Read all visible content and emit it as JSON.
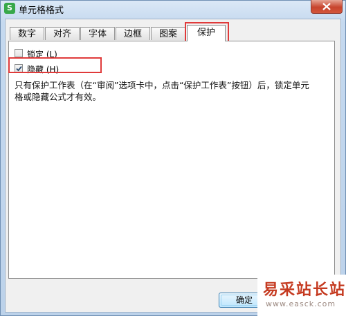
{
  "window": {
    "title": "单元格格式",
    "app_icon_letter": "S"
  },
  "tabs": [
    {
      "label": "数字",
      "active": false
    },
    {
      "label": "对齐",
      "active": false
    },
    {
      "label": "字体",
      "active": false
    },
    {
      "label": "边框",
      "active": false
    },
    {
      "label": "图案",
      "active": false
    },
    {
      "label": "保护",
      "active": true
    }
  ],
  "protection": {
    "locked": {
      "label": "锁定 (L)",
      "checked": false
    },
    "hidden": {
      "label": "隐藏 (H)",
      "checked": true
    },
    "description": "只有保护工作表（在“审阅”选项卡中，点击“保护工作表”按钮）后，锁定单元格或隐藏公式才有效。"
  },
  "footer": {
    "ok_label": "确定"
  },
  "watermark": {
    "text": "易采站长站",
    "url": "www.easck.com"
  },
  "colors": {
    "highlight": "#e03a3a",
    "watermark": "#c53a20"
  }
}
